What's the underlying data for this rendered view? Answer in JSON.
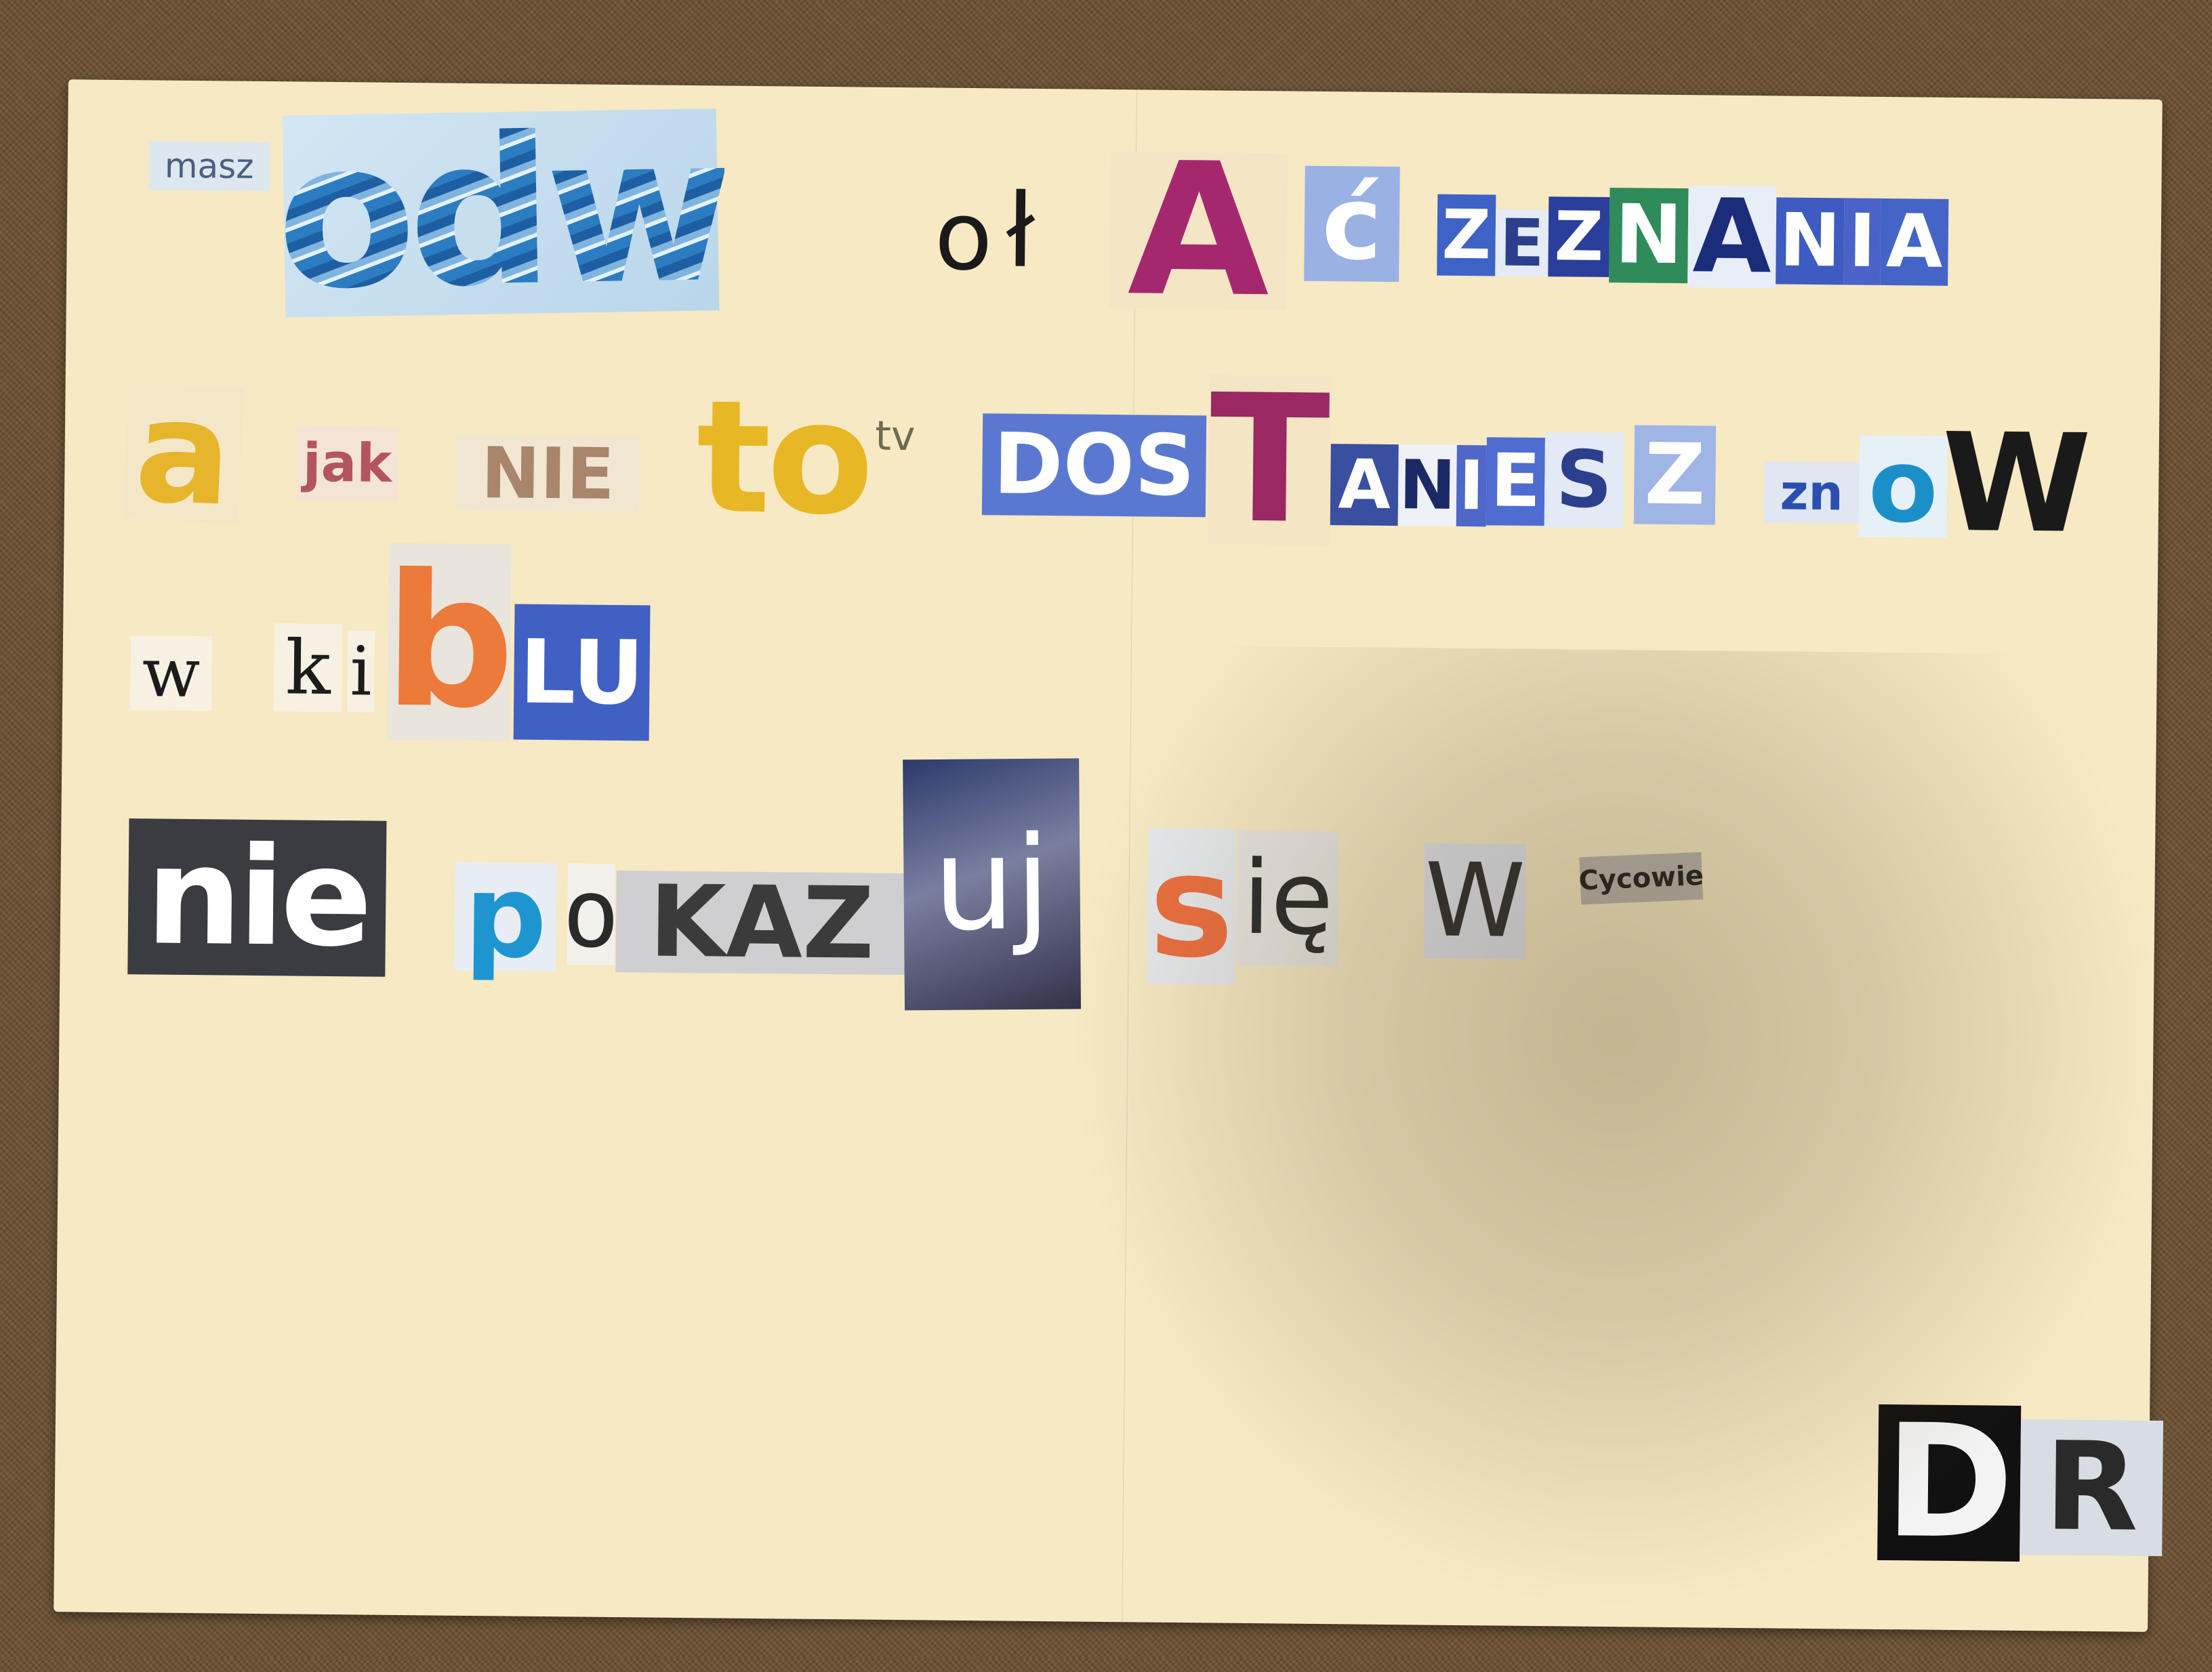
{
  "note": {
    "line1": {
      "masz": "masz",
      "odw": "odw",
      "o": "o",
      "l": "ł",
      "a": "A",
      "c": "ć",
      "zeznania": [
        "Z",
        "E",
        "Z",
        "N",
        "A",
        "N",
        "I",
        "A"
      ]
    },
    "line2": {
      "a": "a",
      "jak": "jak",
      "nie": "NIE",
      "to": "to",
      "tv": "tv",
      "dos": "DOS",
      "t": "T",
      "aniesz": [
        "A",
        "N",
        "I",
        "E",
        "S",
        "Z"
      ],
      "zn": "zn",
      "o": "o",
      "w": "W"
    },
    "line3": {
      "w": "w",
      "k": "k",
      "i": "i",
      "b": "b",
      "lu": "LU"
    },
    "line4": {
      "nie": "nie",
      "p": "p",
      "o": "o",
      "kaz": "KAZ",
      "uj": "uj",
      "s": "s",
      "ie": "ię",
      "w": "W",
      "cycowie": "Cycowie"
    },
    "signature": {
      "d": "D",
      "r": "R"
    }
  },
  "colors": {
    "paper": "#f6e9c3",
    "carpet": "#6e5233",
    "magenta": "#a5286f",
    "yellow": "#e6b52c",
    "orange": "#ec7a3a",
    "blue": "#3c5fc2"
  }
}
